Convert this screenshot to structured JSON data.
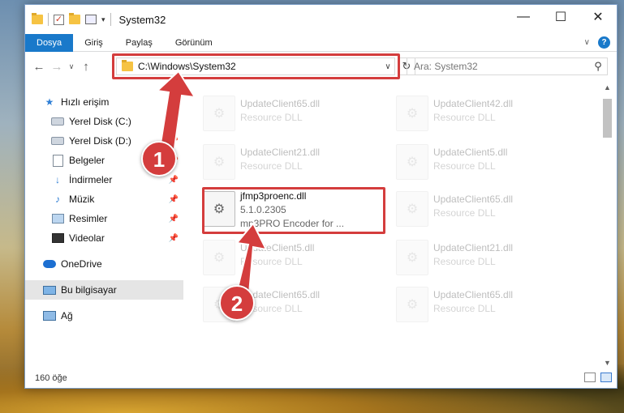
{
  "window": {
    "title": "System32"
  },
  "titlebar": {
    "minimize_icon": "minimize-icon",
    "maximize_icon": "maximize-icon",
    "close_icon": "close-icon"
  },
  "ribbon": {
    "tabs": [
      {
        "label": "Dosya",
        "active": true
      },
      {
        "label": "Giriş",
        "active": false
      },
      {
        "label": "Paylaş",
        "active": false
      },
      {
        "label": "Görünüm",
        "active": false
      }
    ]
  },
  "nav": {
    "address": "C:\\Windows\\System32",
    "search_placeholder": "Ara: System32"
  },
  "sidebar": {
    "items": [
      {
        "label": "Hızlı erişim",
        "icon": "star-icon",
        "pinned": false
      },
      {
        "label": "Yerel Disk (C:)",
        "icon": "drive-icon",
        "pinned": true
      },
      {
        "label": "Yerel Disk (D:)",
        "icon": "drive-icon",
        "pinned": true
      },
      {
        "label": "Belgeler",
        "icon": "document-icon",
        "pinned": true
      },
      {
        "label": "İndirmeler",
        "icon": "download-icon",
        "pinned": true
      },
      {
        "label": "Müzik",
        "icon": "music-icon",
        "pinned": true
      },
      {
        "label": "Resimler",
        "icon": "pictures-icon",
        "pinned": true
      },
      {
        "label": "Videolar",
        "icon": "video-icon",
        "pinned": true
      },
      {
        "label": "OneDrive",
        "icon": "cloud-icon",
        "pinned": false
      },
      {
        "label": "Bu bilgisayar",
        "icon": "computer-icon",
        "pinned": false,
        "selected": true
      },
      {
        "label": "Ağ",
        "icon": "network-icon",
        "pinned": false
      }
    ]
  },
  "files": [
    {
      "name": "UpdateClient65.dll",
      "sub": "Resource DLL"
    },
    {
      "name": "UpdateClient42.dll",
      "sub": "Resource DLL"
    },
    {
      "name": "UpdateClient21.dll",
      "sub": "Resource DLL"
    },
    {
      "name": "UpdateClient5.dll",
      "sub": "Resource DLL"
    },
    {
      "name": "jfmp3proenc.dll",
      "version": "5.1.0.2305",
      "sub": "mp3PRO Encoder for ..."
    },
    {
      "name": "UpdateClient65.dll",
      "sub": "Resource DLL"
    },
    {
      "name": "UpdateClient5.dll",
      "sub": "Resource DLL"
    },
    {
      "name": "UpdateClient21.dll",
      "sub": "Resource DLL"
    },
    {
      "name": "UpdateClient65.dll",
      "sub": "Resource DLL"
    },
    {
      "name": "UpdateClient65.dll",
      "sub": "Resource DLL"
    }
  ],
  "status": {
    "count": "160 öğe"
  },
  "callouts": {
    "one": "1",
    "two": "2"
  },
  "colors": {
    "accent": "#1979ca",
    "highlight": "#d43d3d"
  }
}
